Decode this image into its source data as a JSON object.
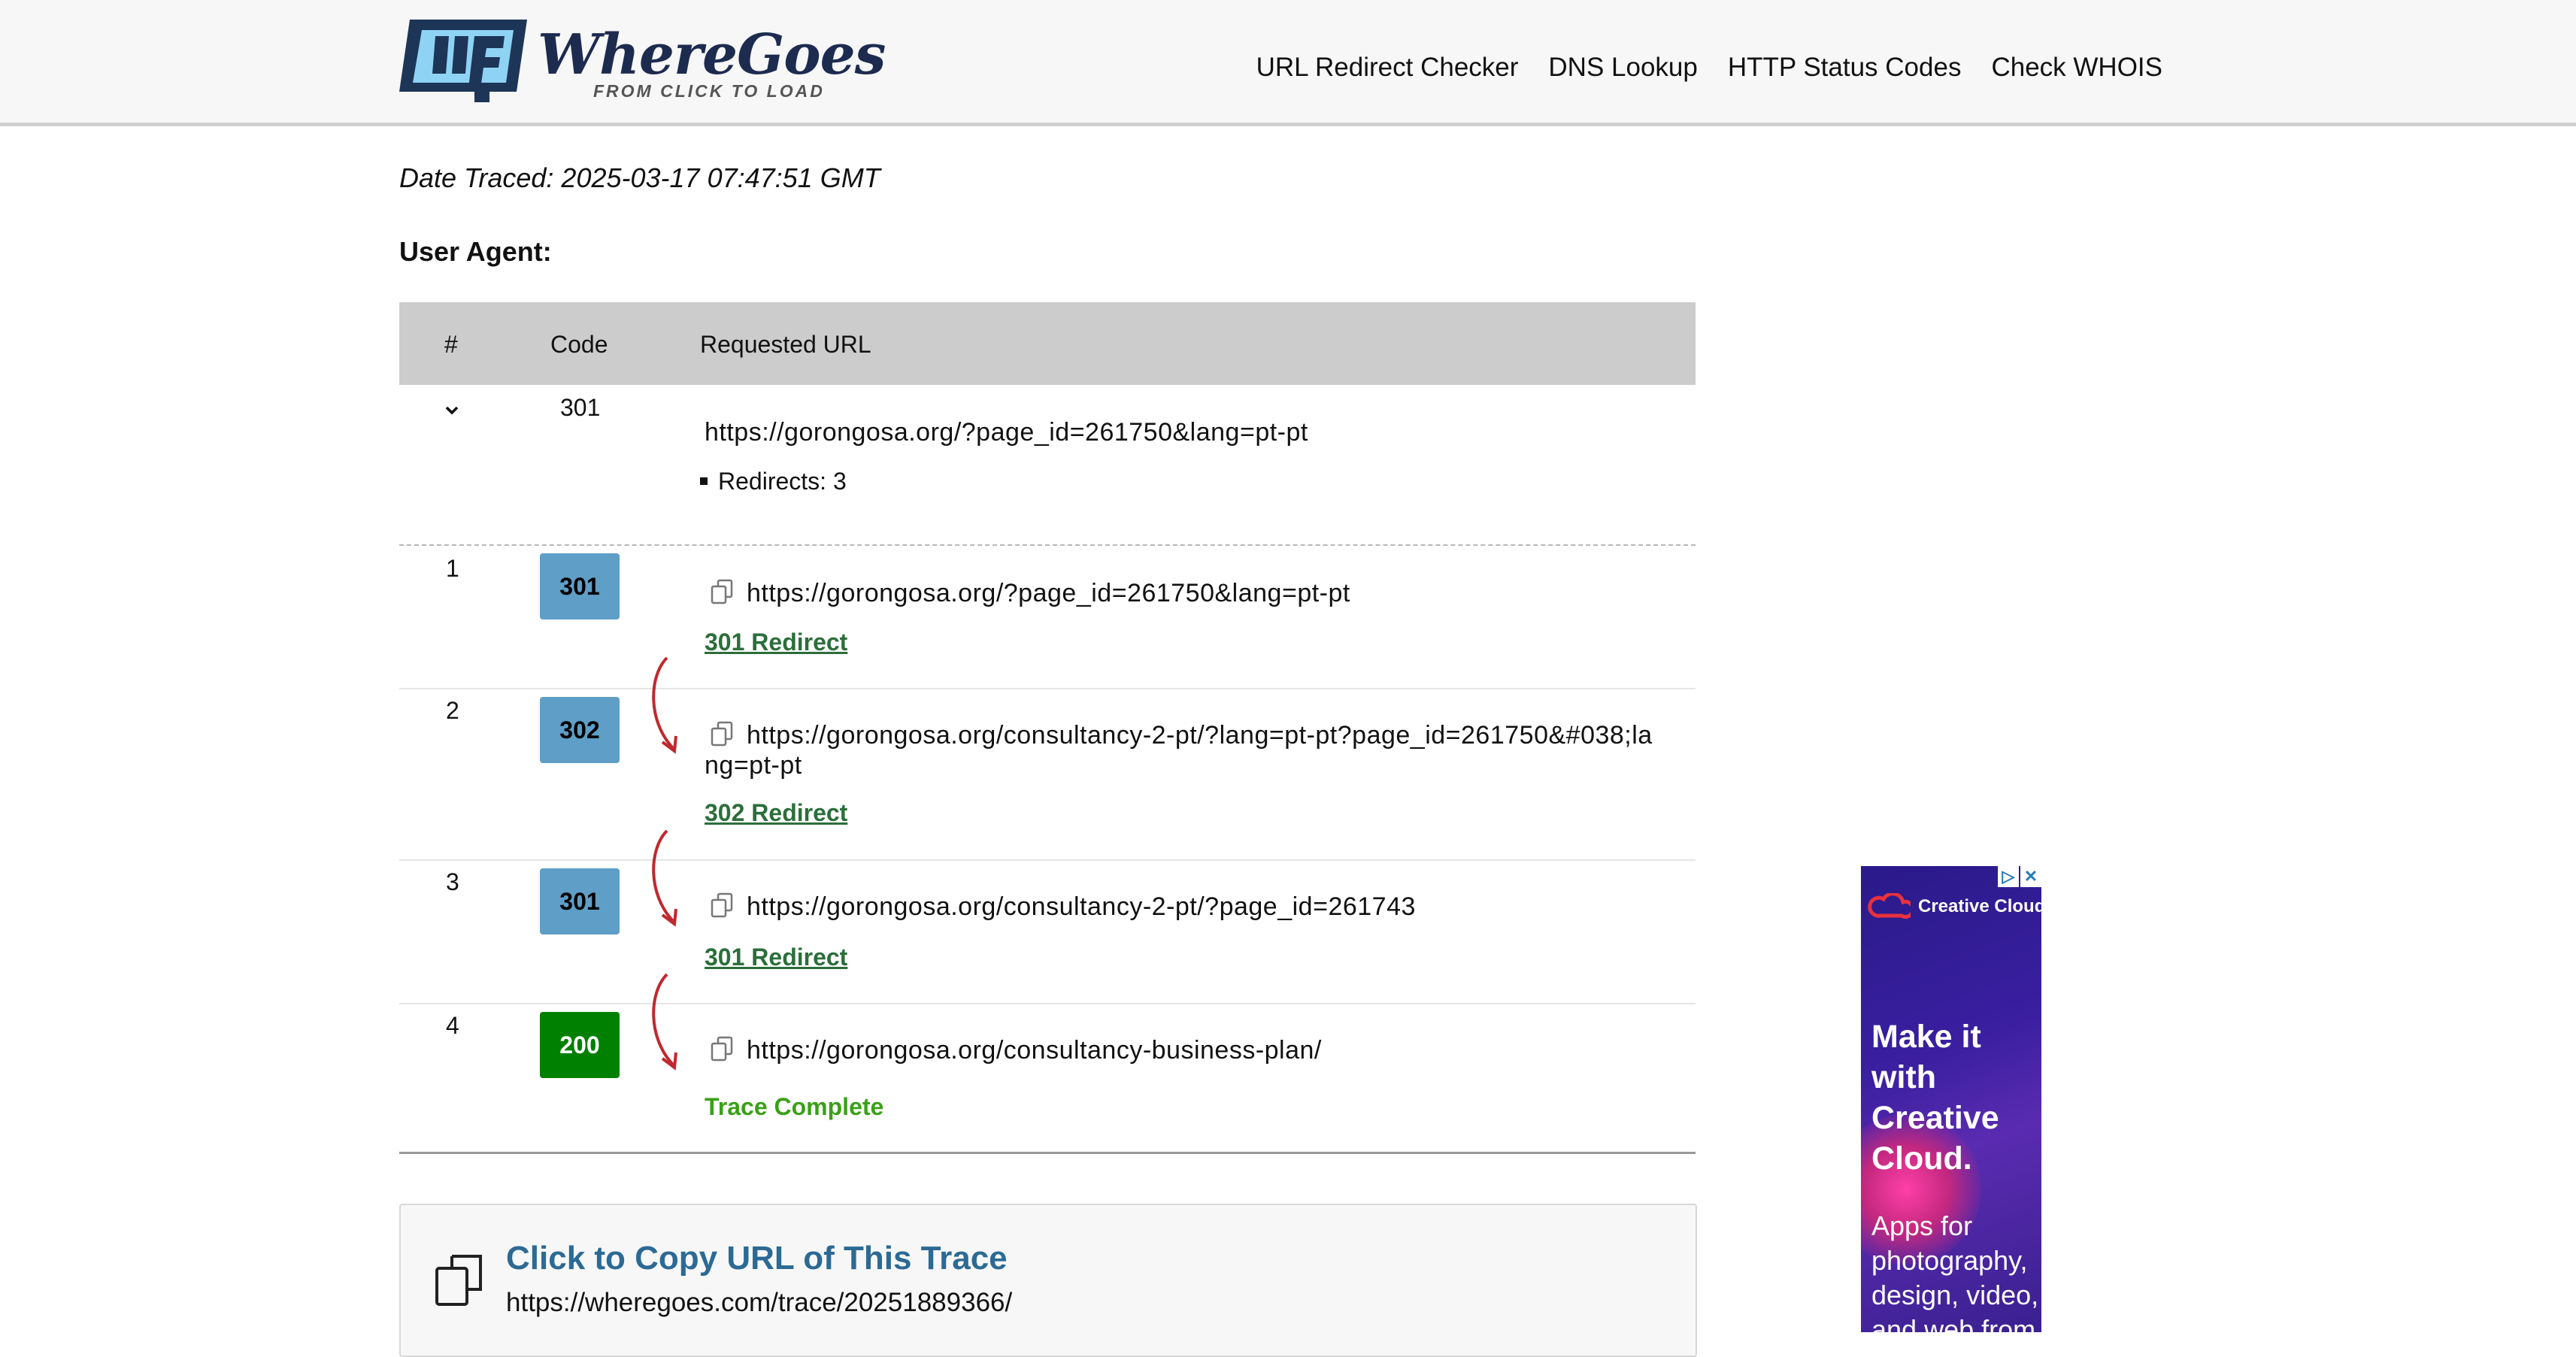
{
  "header": {
    "logo_text": "WhereGoes",
    "logo_tagline": "FROM CLICK TO LOAD",
    "nav": [
      "URL Redirect Checker",
      "DNS Lookup",
      "HTTP Status Codes",
      "Check WHOIS"
    ]
  },
  "meta": {
    "date_traced": "Date Traced: 2025-03-17 07:47:51 GMT",
    "user_agent_label": "User Agent:"
  },
  "table": {
    "headers": [
      "#",
      "Code",
      "Requested URL"
    ],
    "summary": {
      "code": "301",
      "url": "https://gorongosa.org/?page_id=261750&lang=pt-pt",
      "redirects": "Redirects: 3"
    },
    "rows": [
      {
        "num": "1",
        "code": "301",
        "url": "https://gorongosa.org/?page_id=261750&lang=pt-pt",
        "status": "301 Redirect"
      },
      {
        "num": "2",
        "code": "302",
        "url": "https://gorongosa.org/consultancy-2-pt/?lang=pt-pt?page_id=261750&#038;la",
        "url_cont": "ng=pt-pt",
        "status": "302 Redirect"
      },
      {
        "num": "3",
        "code": "301",
        "url": "https://gorongosa.org/consultancy-2-pt/?page_id=261743",
        "status": "301 Redirect"
      },
      {
        "num": "4",
        "code": "200",
        "url": "https://gorongosa.org/consultancy-business-plan/",
        "status": "Trace Complete"
      }
    ]
  },
  "copy_box": {
    "title": "Click to Copy URL of This Trace",
    "url": "https://wheregoes.com/trace/20251889366/"
  },
  "ad": {
    "brand": "Creative Cloud",
    "headline": "Make it\nwith\nCreative\nCloud.",
    "body": "Apps for\nphotography,\ndesign, video,\nand web from"
  },
  "colors": {
    "badge_redirect": "#5e9ec7",
    "badge_ok": "#008000",
    "redirect_link": "#2b6e3a",
    "trace_complete": "#3aa018",
    "arrow": "#c0282d",
    "copy_title": "#2c6a94"
  }
}
